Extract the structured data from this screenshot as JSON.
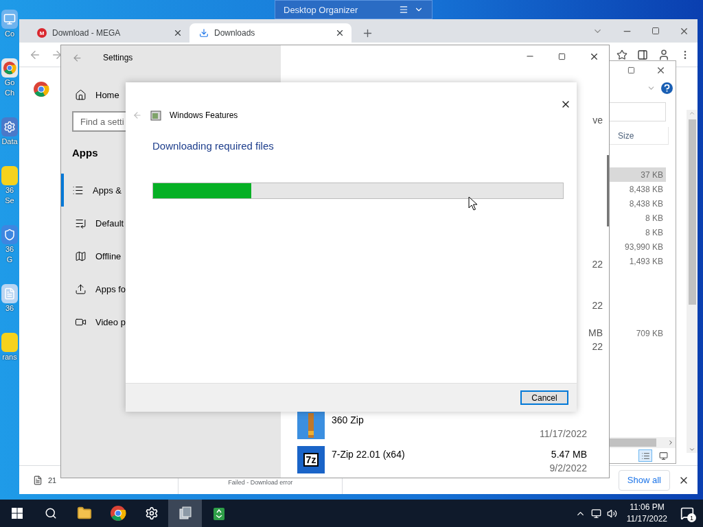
{
  "desktop_icons": [
    {
      "kind": "computer",
      "lines": [
        "Co"
      ]
    },
    {
      "kind": "chrome",
      "lines": [
        "Go",
        "Ch"
      ]
    },
    {
      "kind": "gear",
      "lines": [
        "Data"
      ]
    },
    {
      "kind": "yellow",
      "lines": [
        "36",
        "Se"
      ]
    },
    {
      "kind": "shield",
      "lines": [
        "36",
        "G"
      ]
    },
    {
      "kind": "doc",
      "lines": [
        "36"
      ]
    },
    {
      "kind": "yellow",
      "lines": [
        "rans"
      ]
    }
  ],
  "organizer": {
    "title": "Desktop Organizer"
  },
  "browser": {
    "tabs": [
      {
        "kind": "mega",
        "icon_text": "M",
        "title": "Download - MEGA",
        "selected": false
      },
      {
        "kind": "download",
        "title": "Downloads",
        "selected": true
      }
    ],
    "shelf": {
      "item_text": "21",
      "status": "Failed - Download error",
      "show_all": "Show all"
    }
  },
  "explorer": {
    "column": "Size",
    "rows": [
      {
        "size": "37 KB",
        "selected": true
      },
      {
        "size": "8,438 KB",
        "selected": false
      },
      {
        "size": "8,438 KB",
        "selected": false
      },
      {
        "size": "8 KB",
        "selected": false
      },
      {
        "size": "8 KB",
        "selected": false
      },
      {
        "size": "93,990 KB",
        "selected": false
      },
      {
        "size": "1,493 KB",
        "selected": false
      }
    ],
    "extra_size": "709 KB"
  },
  "settings": {
    "title": "Settings",
    "home": "Home",
    "search_placeholder": "Find a setti",
    "section": "Apps",
    "nav": [
      {
        "kind": "list",
        "label": "Apps &",
        "selected": true
      },
      {
        "kind": "default",
        "label": "Default",
        "selected": false
      },
      {
        "kind": "map",
        "label": "Offline",
        "selected": false
      },
      {
        "kind": "upload",
        "label": "Apps fo",
        "selected": false
      },
      {
        "kind": "video",
        "label": "Video p",
        "selected": false
      }
    ],
    "fragments": [
      "ve",
      "22",
      "22",
      "MB",
      "22"
    ],
    "apps": [
      {
        "kind": "zip360",
        "name": "360 Zip",
        "date": "11/17/2022"
      },
      {
        "kind": "sevenzip",
        "icon_text": "7z",
        "name": "7-Zip 22.01 (x64)",
        "size": "5.47 MB",
        "date": "9/2/2022"
      }
    ]
  },
  "dialog": {
    "title": "Windows Features",
    "heading": "Downloading required files",
    "level": 0.24,
    "cancel": "Cancel"
  },
  "taskbar": {
    "apps": [
      {
        "kind": "search",
        "selected": false
      },
      {
        "kind": "folder",
        "selected": false
      },
      {
        "kind": "chrome",
        "selected": false
      },
      {
        "kind": "gear",
        "selected": false
      },
      {
        "kind": "features",
        "selected": true
      },
      {
        "kind": "recycle",
        "selected": false
      }
    ],
    "time": "11:06 PM",
    "date": "11/17/2022",
    "notifications": "1"
  }
}
